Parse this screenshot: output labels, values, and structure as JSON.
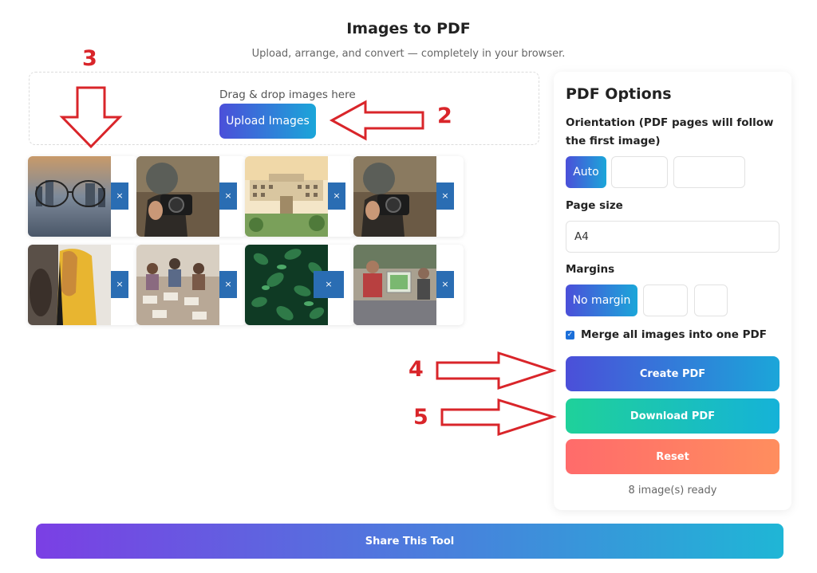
{
  "header": {
    "title": "Images to PDF",
    "subtitle": "Upload, arrange, and convert — completely in your browser."
  },
  "dropzone": {
    "label": "Drag & drop images here",
    "upload_button": "Upload Images"
  },
  "thumbnails": {
    "remove_label": "×",
    "items": [
      {
        "subject": "city skyline through glasses"
      },
      {
        "subject": "person with camera"
      },
      {
        "subject": "campus building"
      },
      {
        "subject": "person with camera"
      },
      {
        "subject": "painting of a woman"
      },
      {
        "subject": "classroom workshop"
      },
      {
        "subject": "green leaves"
      },
      {
        "subject": "people at an exhibit"
      }
    ]
  },
  "options": {
    "title": "PDF Options",
    "orientation_label": "Orientation (PDF pages will follow the first image)",
    "orientation_options": [
      "Auto",
      "",
      ""
    ],
    "orientation_selected": "Auto",
    "page_size_label": "Page size",
    "page_size_value": "A4",
    "margins_label": "Margins",
    "margin_options": [
      "No margin",
      "",
      ""
    ],
    "margin_selected": "No margin",
    "merge_label": "Merge all images into one PDF",
    "merge_checked": true,
    "create_button": "Create PDF",
    "download_button": "Download PDF",
    "reset_button": "Reset",
    "status": "8 image(s) ready"
  },
  "share_button": "Share This Tool",
  "annotations": [
    "3",
    "2",
    "4",
    "5"
  ],
  "colors": {
    "primary_gradient_start": "#4b4fd9",
    "primary_gradient_end": "#1ba6d9",
    "download_gradient_start": "#1fd19a",
    "reset_gradient_start": "#ff6b6b",
    "share_gradient_start": "#7b3fe4",
    "annotation_red": "#d9252a"
  }
}
